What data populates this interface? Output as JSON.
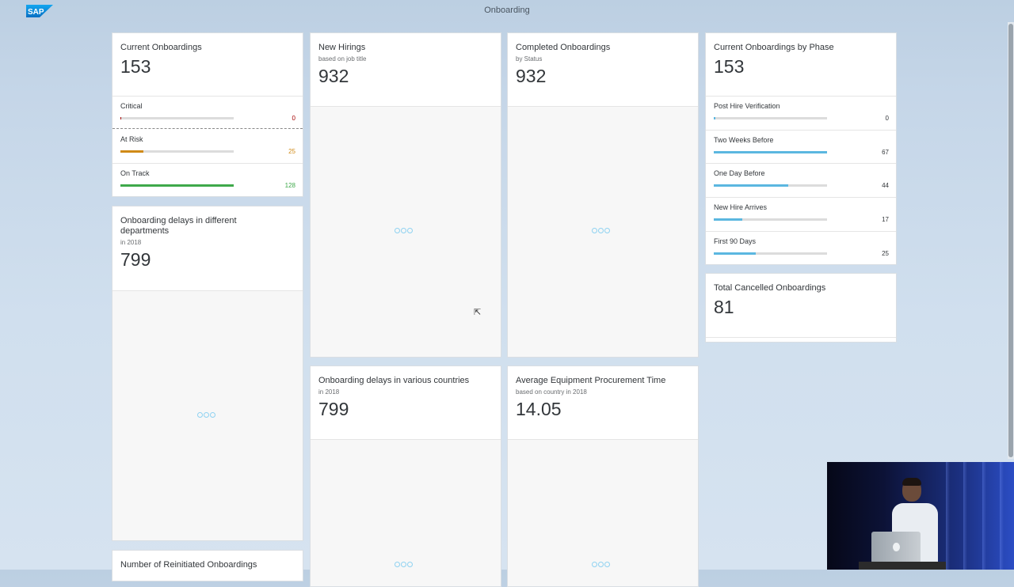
{
  "shell": {
    "logo_text": "SAP",
    "title": "Onboarding"
  },
  "cards": {
    "current_onboardings": {
      "title": "Current Onboardings",
      "kpi": "153",
      "rows": [
        {
          "label": "Critical",
          "value": "0",
          "fraction": 0.01,
          "color": "#a50000"
        },
        {
          "label": "At Risk",
          "value": "25",
          "fraction": 0.2,
          "color": "#d08a17"
        },
        {
          "label": "On Track",
          "value": "128",
          "fraction": 1.0,
          "color": "#3fa94b"
        }
      ]
    },
    "new_hirings": {
      "title": "New Hirings",
      "subtitle": "based on job title",
      "kpi": "932"
    },
    "completed_onboardings": {
      "title": "Completed Onboardings",
      "subtitle": "by Status",
      "kpi": "932"
    },
    "by_phase": {
      "title": "Current Onboardings by Phase",
      "kpi": "153",
      "bar_color": "#5bb7e0",
      "rows": [
        {
          "label": "Post Hire Verification",
          "value": "0",
          "fraction": 0.015
        },
        {
          "label": "Two Weeks Before",
          "value": "67",
          "fraction": 1.0
        },
        {
          "label": "One Day Before",
          "value": "44",
          "fraction": 0.66
        },
        {
          "label": "New Hire Arrives",
          "value": "17",
          "fraction": 0.25
        },
        {
          "label": "First 90 Days",
          "value": "25",
          "fraction": 0.37
        }
      ]
    },
    "delays_departments": {
      "title": "Onboarding delays in different departments",
      "subtitle": "in 2018",
      "kpi": "799"
    },
    "total_cancelled": {
      "title": "Total Cancelled Onboardings",
      "kpi": "81"
    },
    "delays_countries": {
      "title": "Onboarding delays in various countries",
      "subtitle": "in 2018",
      "kpi": "799"
    },
    "equipment_time": {
      "title": "Average Equipment Procurement Time",
      "subtitle": "based on country in 2018",
      "kpi": "14.05"
    },
    "reinitiated": {
      "title": "Number of Reinitiated Onboardings"
    }
  },
  "icons": {
    "loader": "loading-dots-icon",
    "cursor": "mouse-cursor-icon"
  }
}
